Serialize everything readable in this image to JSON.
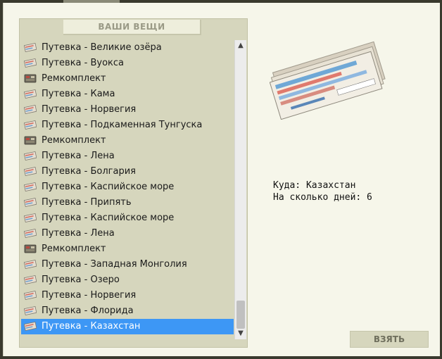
{
  "panel": {
    "tab_title": "ВАШИ ВЕЩИ"
  },
  "items": [
    {
      "label": "Путевка - Великие озёра",
      "icon": "ticket-icon"
    },
    {
      "label": "Путевка - Вуокса",
      "icon": "ticket-icon"
    },
    {
      "label": "Ремкомплект",
      "icon": "repair-kit-icon"
    },
    {
      "label": "Путевка - Кама",
      "icon": "ticket-icon"
    },
    {
      "label": "Путевка - Норвегия",
      "icon": "ticket-icon"
    },
    {
      "label": "Путевка - Подкаменная Тунгуска",
      "icon": "ticket-icon"
    },
    {
      "label": "Ремкомплект",
      "icon": "repair-kit-icon"
    },
    {
      "label": "Путевка - Лена",
      "icon": "ticket-icon"
    },
    {
      "label": "Путевка - Болгария",
      "icon": "ticket-icon"
    },
    {
      "label": "Путевка - Каспийское море",
      "icon": "ticket-icon"
    },
    {
      "label": "Путевка - Припять",
      "icon": "ticket-icon"
    },
    {
      "label": "Путевка - Каспийское море",
      "icon": "ticket-icon"
    },
    {
      "label": "Путевка - Лена",
      "icon": "ticket-icon"
    },
    {
      "label": "Ремкомплект",
      "icon": "repair-kit-icon"
    },
    {
      "label": "Путевка - Западная Монголия",
      "icon": "ticket-icon"
    },
    {
      "label": "Путевка - Озеро",
      "icon": "ticket-icon"
    },
    {
      "label": "Путевка - Норвегия",
      "icon": "ticket-icon"
    },
    {
      "label": "Путевка - Флорида",
      "icon": "ticket-icon"
    },
    {
      "label": "Путевка - Казахстан",
      "icon": "ticket-icon",
      "selected": true
    }
  ],
  "details": {
    "destination": "Куда: Казахстан",
    "days": "На сколько дней: 6"
  },
  "actions": {
    "take_label": "ВЗЯТЬ"
  },
  "colors": {
    "panel_bg": "#d6d6bd",
    "selection": "#3d97f5"
  }
}
